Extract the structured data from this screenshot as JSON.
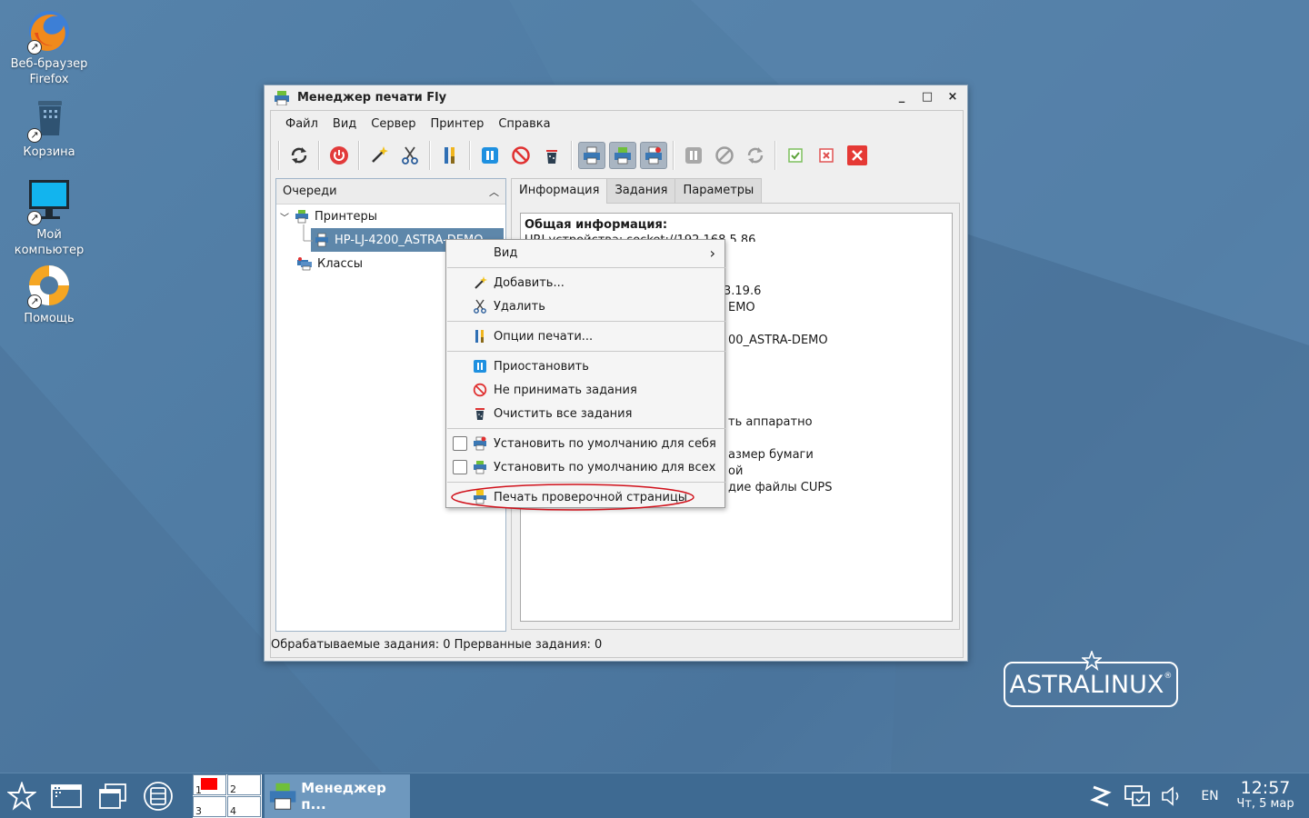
{
  "desktop": {
    "icons": [
      {
        "label_line1": "Веб-браузер",
        "label_line2": "Firefox"
      },
      {
        "label_line1": "Корзина",
        "label_line2": ""
      },
      {
        "label_line1": "Мой",
        "label_line2": "компьютер"
      },
      {
        "label_line1": "Помощь",
        "label_line2": ""
      }
    ],
    "logo_text": "ASTRALINUX",
    "logo_mark": "®"
  },
  "window": {
    "title": "Менеджер печати Fly",
    "controls": {
      "minimize": "_",
      "maximize": "□",
      "close": "×"
    },
    "menu": [
      "Файл",
      "Вид",
      "Сервер",
      "Принтер",
      "Справка"
    ],
    "left_panel": {
      "header": "Очереди",
      "tree": {
        "printers_label": "Принтеры",
        "printer_item": "HP-LJ-4200_ASTRA-DEMO",
        "classes_label": "Классы"
      }
    },
    "tabs": [
      "Информация",
      "Задания",
      "Параметры"
    ],
    "info": {
      "heading": "Общая информация:",
      "uri_line": "URI устройства: socket://192.168.5.86",
      "fragments": [
        "3.19.6",
        "EMO",
        "00_ASTRA-DEMO",
        "ть аппаратно",
        "азмер бумаги",
        "ой",
        "дие файлы CUPS"
      ]
    },
    "statusbar": "Обрабатываемые задания: 0  Прерванные задания: 0"
  },
  "context_menu": {
    "view": "Вид",
    "view_arrow": "›",
    "add": "Добавить...",
    "delete": "Удалить",
    "print_options": "Опции печати...",
    "pause": "Приостановить",
    "reject_jobs": "Не принимать задания",
    "clear_jobs": "Очистить все задания",
    "default_self": "Установить по умолчанию для себя",
    "default_all": "Установить по умолчанию для всех",
    "test_page": "Печать проверочной страницы"
  },
  "taskbar": {
    "pager": [
      "1",
      "2",
      "3",
      "4"
    ],
    "active_task": "Менеджер п...",
    "lang": "EN",
    "time": "12:57",
    "date": "Чт,  5 мар"
  },
  "colors": {
    "desktop": "#4f7ba3",
    "taskbar": "#3e6a92",
    "selection": "#5e87aa",
    "highlight_ellipse": "#d0101a"
  }
}
